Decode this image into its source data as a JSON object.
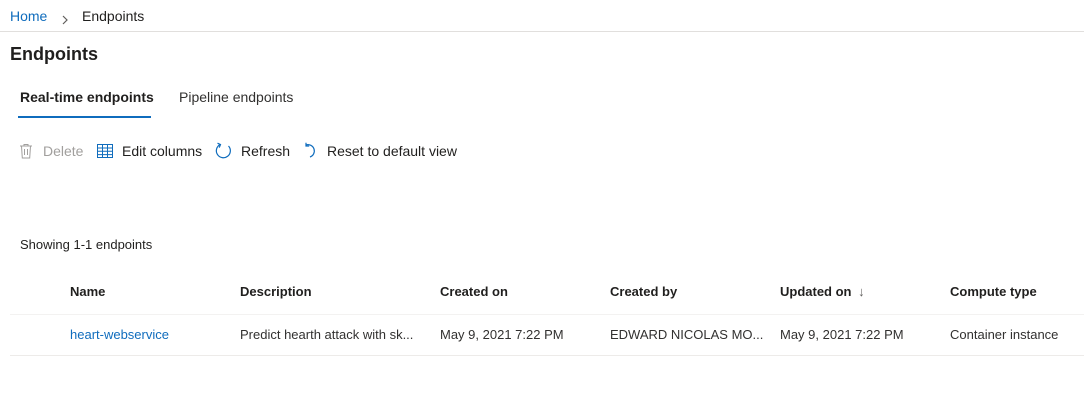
{
  "breadcrumb": {
    "home": "Home",
    "current": "Endpoints"
  },
  "page": {
    "title": "Endpoints"
  },
  "tabs": [
    {
      "label": "Real-time endpoints",
      "active": true
    },
    {
      "label": "Pipeline endpoints",
      "active": false
    }
  ],
  "toolbar": {
    "delete_label": "Delete",
    "edit_columns_label": "Edit columns",
    "refresh_label": "Refresh",
    "reset_label": "Reset to default view"
  },
  "list": {
    "count_text": "Showing 1-1 endpoints",
    "columns": [
      "Name",
      "Description",
      "Created on",
      "Created by",
      "Updated on",
      "Compute type"
    ],
    "sort_indicator": "↓",
    "rows": [
      {
        "name": "heart-webservice",
        "description": "Predict hearth attack with sk...",
        "created_on": "May 9, 2021 7:22 PM",
        "created_by": "EDWARD NICOLAS MO...",
        "updated_on": "May 9, 2021 7:22 PM",
        "compute_type": "Container instance"
      }
    ]
  },
  "colors": {
    "accent": "#0f6cbd",
    "text": "#201f1e",
    "disabled": "#a19f9d",
    "divider": "#e1dfdd"
  }
}
